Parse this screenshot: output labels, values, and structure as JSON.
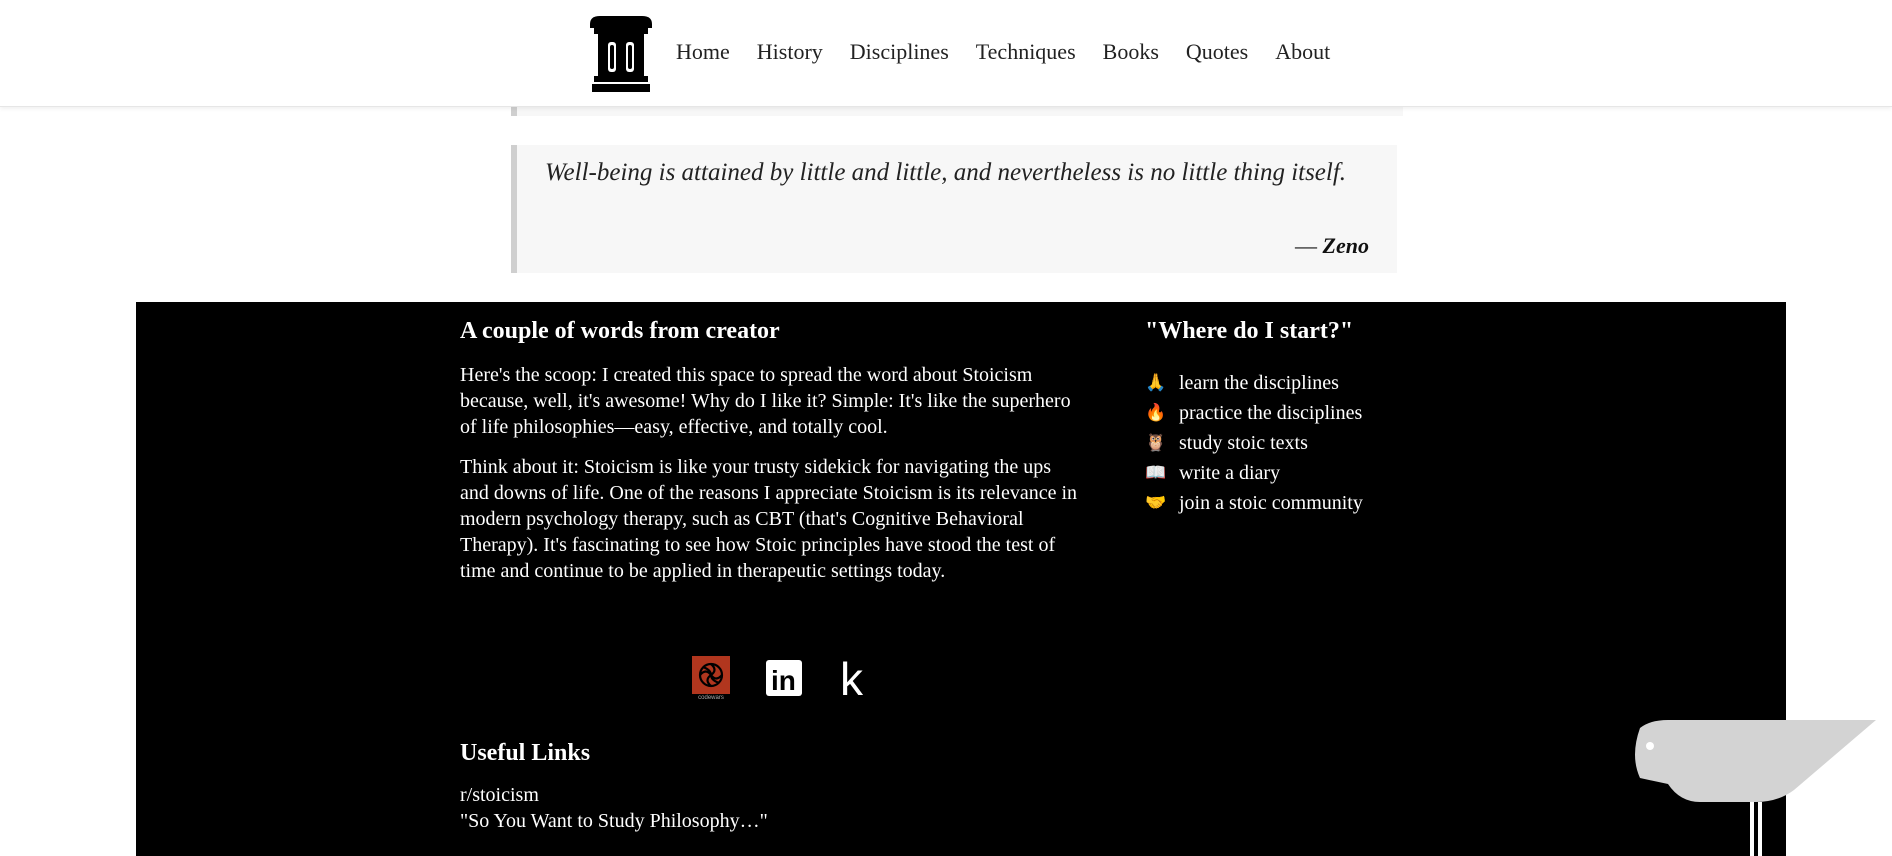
{
  "header": {
    "logo_icon": "greek-column-icon",
    "nav": [
      {
        "label": "Home"
      },
      {
        "label": "History"
      },
      {
        "label": "Disciplines"
      },
      {
        "label": "Techniques"
      },
      {
        "label": "Books"
      },
      {
        "label": "Quotes"
      },
      {
        "label": "About"
      }
    ]
  },
  "quote": {
    "text": "Well-being is attained by little and little, and nevertheless is no little thing itself.",
    "author_prefix": "— ",
    "author": "Zeno"
  },
  "footer": {
    "creator": {
      "title": "A couple of words from creator",
      "paragraphs": [
        "Here's the scoop: I created this space to spread the word about Stoicism because, well, it's awesome! Why do I like it? Simple: It's like the superhero of life philosophies—easy, effective, and totally cool.",
        "Think about it: Stoicism is like your trusty sidekick for navigating the ups and downs of life. One of the reasons I appreciate Stoicism is its relevance in modern psychology therapy, such as CBT (that's Cognitive Behavioral Therapy). It's fascinating to see how Stoic principles have stood the test of time and continue to be applied in therapeutic settings today."
      ]
    },
    "socials": [
      {
        "icon": "codewars-icon",
        "caption": "codewars"
      },
      {
        "icon": "linkedin-icon",
        "caption": "in"
      },
      {
        "icon": "kaggle-icon",
        "caption": "k"
      }
    ],
    "start": {
      "title": "\"Where do I start?\"",
      "items": [
        {
          "icon": "praying-hands-icon",
          "glyph": "🙏",
          "label": "learn the disciplines"
        },
        {
          "icon": "fire-icon",
          "glyph": "🔥",
          "label": "practice the disciplines"
        },
        {
          "icon": "owl-icon",
          "glyph": "🦉",
          "label": "study stoic texts"
        },
        {
          "icon": "open-book-icon",
          "glyph": "📖",
          "label": "write a diary"
        },
        {
          "icon": "handshake-icon",
          "glyph": "🤝",
          "label": "join a stoic community"
        }
      ]
    },
    "useful_links": {
      "title": "Useful Links",
      "links": [
        {
          "label": "r/stoicism"
        },
        {
          "label": "\"So You Want to Study Philosophy…\""
        }
      ]
    }
  },
  "colors": {
    "footer_bg": "#000000",
    "quote_bg": "#f7f7f7",
    "quote_border": "#cfcfcf",
    "codewars_red": "#b1361e",
    "bird_gray": "#d3d3d3"
  }
}
